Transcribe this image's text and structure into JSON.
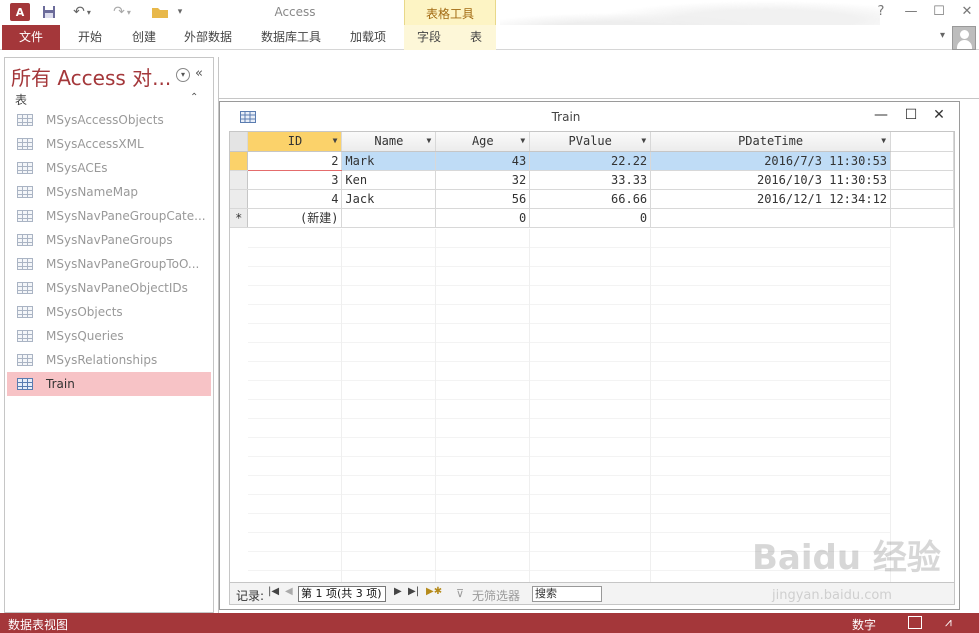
{
  "titlebar": {
    "app_title": "Access",
    "context_tab_group": "表格工具",
    "help": "?",
    "minimize": "—",
    "restore": "☐",
    "close": "✕"
  },
  "ribbon": {
    "tabs": [
      {
        "label": "文件"
      },
      {
        "label": "开始"
      },
      {
        "label": "创建"
      },
      {
        "label": "外部数据"
      },
      {
        "label": "数据库工具"
      },
      {
        "label": "加载项"
      },
      {
        "label": "字段"
      },
      {
        "label": "表"
      }
    ]
  },
  "nav": {
    "title": "所有 Access 对...",
    "group": "表",
    "items": [
      {
        "label": "MSysAccessObjects"
      },
      {
        "label": "MSysAccessXML"
      },
      {
        "label": "MSysACEs"
      },
      {
        "label": "MSysNameMap"
      },
      {
        "label": "MSysNavPaneGroupCate..."
      },
      {
        "label": "MSysNavPaneGroups"
      },
      {
        "label": "MSysNavPaneGroupToO..."
      },
      {
        "label": "MSysNavPaneObjectIDs"
      },
      {
        "label": "MSysObjects"
      },
      {
        "label": "MSysQueries"
      },
      {
        "label": "MSysRelationships"
      },
      {
        "label": "Train"
      }
    ]
  },
  "table_window": {
    "title": "Train",
    "columns": [
      "ID",
      "Name",
      "Age",
      "PValue",
      "PDateTime"
    ],
    "rows": [
      {
        "id": "2",
        "name": "Mark",
        "age": "43",
        "pvalue": "22.22",
        "pdatetime": "2016/7/3 11:30:53"
      },
      {
        "id": "3",
        "name": "Ken",
        "age": "32",
        "pvalue": "33.33",
        "pdatetime": "2016/10/3 11:30:53"
      },
      {
        "id": "4",
        "name": "Jack",
        "age": "56",
        "pvalue": "66.66",
        "pdatetime": "2016/12/1 12:34:12"
      }
    ],
    "new_row": {
      "marker": "*",
      "id": "(新建)",
      "age": "0",
      "pvalue": "0"
    }
  },
  "record_nav": {
    "label": "记录:",
    "position": "第 1 项(共 3 项)",
    "no_filter": "无筛选器",
    "search": "搜索"
  },
  "statusbar": {
    "view": "数据表视图",
    "numlock": "数字"
  },
  "watermark": {
    "brand": "Baidu 经验",
    "url": "jingyan.baidu.com"
  }
}
